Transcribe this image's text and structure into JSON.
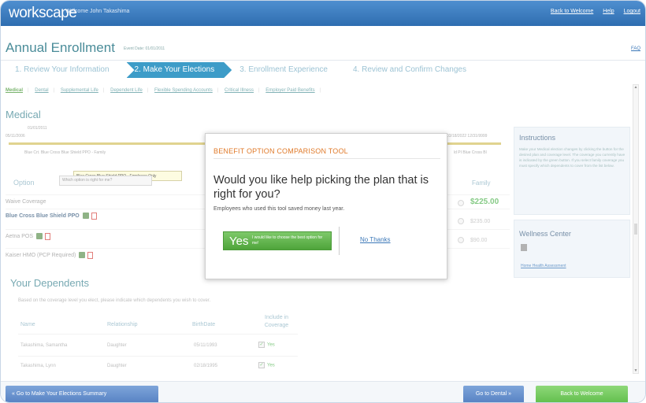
{
  "app": {
    "logo": "workscape",
    "welcome": "Welcome John Takashima",
    "links": [
      "Back to Welcome",
      "Help",
      "Logout"
    ]
  },
  "page": {
    "title": "Annual Enrollment",
    "event_date": "Event Date: 01/01/2011",
    "faq": "FAQ"
  },
  "steps": [
    {
      "label": "1. Review Your Information",
      "active": false
    },
    {
      "label": "2. Make Your Elections",
      "active": true
    },
    {
      "label": "3. Enrollment Experience",
      "active": false
    },
    {
      "label": "4. Review and Confirm Changes",
      "active": false
    }
  ],
  "subnav": [
    "Medical",
    "Dental",
    "Supplemental Life",
    "Dependent Life",
    "Flexible Spending Accounts",
    "Critical Illness",
    "Employer Paid Benefits"
  ],
  "medical": {
    "title": "Medical",
    "timeline": {
      "top_date": "01/01/2011",
      "start": "05/11/2006",
      "end_dates": "03/18/2022   12/31/9999",
      "left_label": "Blue Crt. Blue Cross Blue Shield PPO - Family",
      "right_label": "ld PI  Blue Cross Bl"
    },
    "tooltip": "Blue Cross Blue Shield PPO - Employee Only",
    "columns": {
      "option": "Option",
      "family": "Family",
      "select": "Which option is right for me?"
    },
    "rows": [
      {
        "name": "Waive Coverage",
        "price": ""
      },
      {
        "name": "Blue Cross Blue Shield PPO",
        "price": "$225.00"
      },
      {
        "name": "Aetna POS",
        "price": "$235.00"
      },
      {
        "name": "Kaiser HMO   (PCP Required)",
        "price": "$90.00"
      }
    ]
  },
  "instructions": {
    "title": "Instructions",
    "text": "Make your Medical election changes by clicking the button for the desired plan and coverage level. The coverage you currently have is indicated by the green button.   If you select family coverage you must specify which dependents to cover from the list below."
  },
  "wellness": {
    "title": "Wellness Center",
    "link": "Home Health Assessment"
  },
  "dependents": {
    "title": "Your Dependents",
    "desc": "Based on the coverage level you elect, please indicate which dependents you wish to cover.",
    "headers": {
      "name": "Name",
      "relationship": "Relationship",
      "birthdate": "BirthDate",
      "include": "Include in Coverage"
    },
    "rows": [
      {
        "name": "Takashima, Samantha",
        "relationship": "Daughter",
        "birthdate": "05/11/1993",
        "include": "Yes"
      },
      {
        "name": "Takashima, Lynn",
        "relationship": "Daughter",
        "birthdate": "02/18/1995",
        "include": "Yes"
      }
    ]
  },
  "footer": {
    "back": "«  Go to Make Your Elections Summary",
    "next": "Go to Dental  »",
    "welcome": "Back to Welcome"
  },
  "modal": {
    "heading": "BENEFIT OPTION COMPARISON TOOL",
    "question": "Would you like help picking the plan that is right for you?",
    "sub": "Employees who used this tool saved money last year.",
    "yes_big": "Yes",
    "yes_small": "I would like to choose the best option for me!",
    "no": "No Thanks"
  },
  "colors": {
    "accent": "#3d9cc8",
    "green": "#5cb85c",
    "orange": "#e07a2a"
  }
}
